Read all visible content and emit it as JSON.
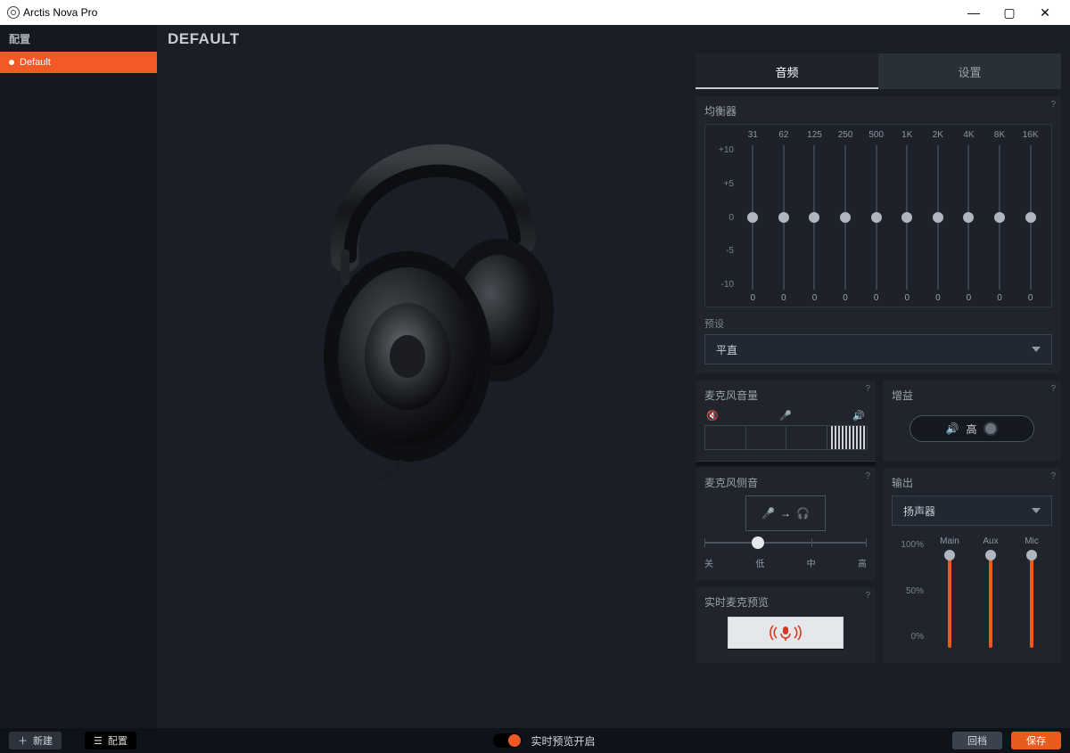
{
  "window": {
    "title": "Arctis Nova Pro"
  },
  "sidebar": {
    "header": "配置",
    "item": "Default",
    "new_btn": "新建"
  },
  "content": {
    "title": "DEFAULT"
  },
  "tabs": {
    "audio": "音频",
    "settings": "设置"
  },
  "eq": {
    "title": "均衡器",
    "bands": [
      "31",
      "62",
      "125",
      "250",
      "500",
      "1K",
      "2K",
      "4K",
      "8K",
      "16K"
    ],
    "scale": [
      "+10",
      "+5",
      "0",
      "-5",
      "-10"
    ],
    "values": [
      "0",
      "0",
      "0",
      "0",
      "0",
      "0",
      "0",
      "0",
      "0",
      "0"
    ],
    "preset_label": "预设",
    "preset_value": "平直"
  },
  "mic_volume": {
    "title": "麦克风音量"
  },
  "gain": {
    "title": "增益",
    "value": "高"
  },
  "sidetone": {
    "title": "麦克风侧音",
    "marks": {
      "off": "关",
      "low": "低",
      "mid": "中",
      "high": "高"
    }
  },
  "output": {
    "title": "输出",
    "value": "扬声器",
    "scale": {
      "p100": "100%",
      "p50": "50%",
      "p0": "0%"
    },
    "cols": {
      "main": "Main",
      "aux": "Aux",
      "mic": "Mic"
    }
  },
  "live_mic": {
    "title": "实时麦克预览"
  },
  "bottom": {
    "config": "配置",
    "live_preview": "实时预览开启",
    "back": "回档",
    "save": "保存"
  }
}
